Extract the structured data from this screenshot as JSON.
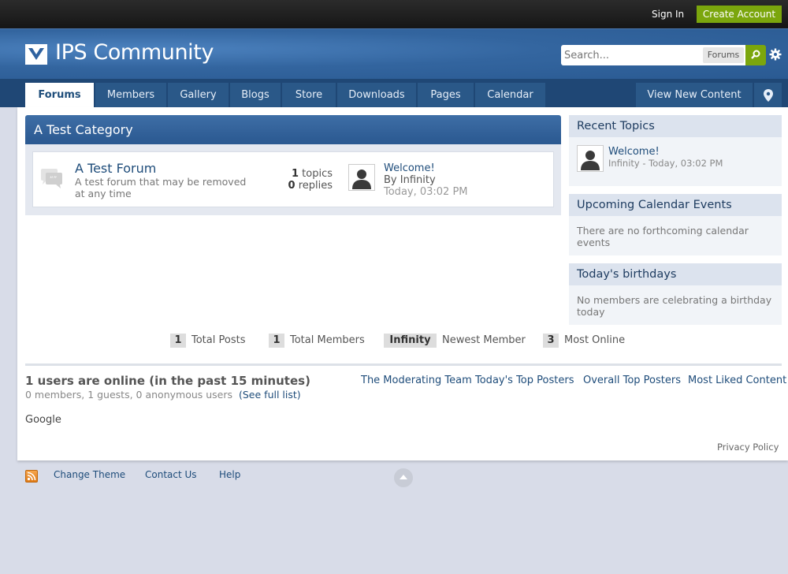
{
  "userbar": {
    "sign_in": "Sign In",
    "create_account": "Create Account"
  },
  "branding": {
    "logo_text": "IPS Community",
    "search_placeholder": "Search...",
    "search_scope": "Forums",
    "colors": {
      "primary": "#2a5a92",
      "accent": "#7ba60d",
      "nav": "#1f4775"
    }
  },
  "nav": {
    "tabs": [
      {
        "label": "Forums",
        "active": true
      },
      {
        "label": "Members"
      },
      {
        "label": "Gallery"
      },
      {
        "label": "Blogs"
      },
      {
        "label": "Store"
      },
      {
        "label": "Downloads"
      },
      {
        "label": "Pages"
      },
      {
        "label": "Calendar"
      }
    ],
    "view_new": "View New Content"
  },
  "category": {
    "title": "A Test Category",
    "forum": {
      "name": "A Test Forum",
      "description": "A test forum that may be removed at any time",
      "topics_count": "1",
      "topics_label": "topics",
      "replies_count": "0",
      "replies_label": "replies",
      "last_post": {
        "title": "Welcome!",
        "by": "By Infinity",
        "date": "Today, 03:02 PM"
      }
    }
  },
  "sidebar": {
    "recent": {
      "title": "Recent Topics",
      "topic": "Welcome!",
      "meta": "Infinity - Today, 03:02 PM"
    },
    "calendar": {
      "title": "Upcoming Calendar Events",
      "text": "There are no forthcoming calendar events"
    },
    "birthdays": {
      "title": "Today's birthdays",
      "text": "No members are celebrating a birthday today"
    }
  },
  "stats": {
    "total_posts": {
      "value": "1",
      "label": "Total Posts"
    },
    "total_members": {
      "value": "1",
      "label": "Total Members"
    },
    "newest_member": {
      "value": "Infinity",
      "label": "Newest Member"
    },
    "most_online": {
      "value": "3",
      "label": "Most Online"
    }
  },
  "online": {
    "title": "1 users are online (in the past 15 minutes)",
    "summary": "0 members, 1 guests, 0 anonymous users",
    "full_list": "(See full list)",
    "bot": "Google",
    "links": [
      "The Moderating Team",
      "Today's Top Posters",
      "Overall Top Posters",
      "Most Liked Content"
    ]
  },
  "privacy": "Privacy Policy",
  "footer": {
    "change_theme": "Change Theme",
    "contact_us": "Contact Us",
    "help": "Help"
  }
}
